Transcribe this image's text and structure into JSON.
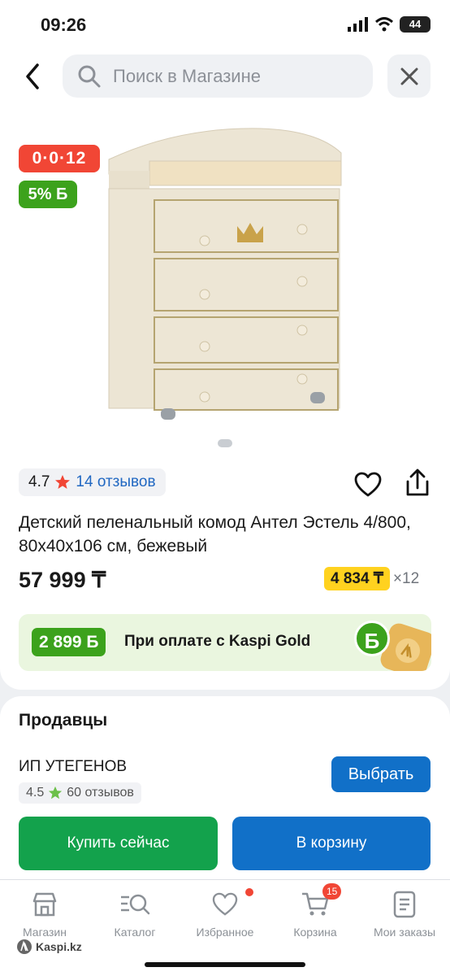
{
  "status_bar": {
    "time": "09:26",
    "battery": "44"
  },
  "search": {
    "placeholder": "Поиск в Магазине"
  },
  "product": {
    "installment_badge": "0·0·12",
    "bonus_badge": "5% Б",
    "rating": "4.7",
    "reviews": "14 отзывов",
    "title": "Детский пеленальный комод Антел Эстель 4/800, 80x40x106 см, бежевый",
    "price": "57 999 ₸",
    "monthly_payment": "4 834 ₸",
    "monthly_term": "×12"
  },
  "kaspi_gold": {
    "bonus_amount": "2 899 Б",
    "text": "При оплате с Kaspi Gold",
    "coin_letter": "Б"
  },
  "sellers": {
    "title": "Продавцы",
    "seller_name": "ИП УТЕГЕНОВ",
    "seller_rating": "4.5",
    "seller_reviews": "60 отзывов",
    "choose_label": "Выбрать"
  },
  "actions": {
    "buy_now": "Купить сейчас",
    "to_cart": "В корзину"
  },
  "nav": {
    "items": [
      {
        "label": "Магазин",
        "icon": "store-icon"
      },
      {
        "label": "Каталог",
        "icon": "catalog-icon"
      },
      {
        "label": "Избранное",
        "icon": "heart-icon"
      },
      {
        "label": "Корзина",
        "icon": "cart-icon"
      },
      {
        "label": "Мои заказы",
        "icon": "orders-icon"
      }
    ],
    "cart_count": "15"
  },
  "watermark": "Kaspi.kz",
  "colors": {
    "red": "#f14635",
    "green": "#3ca21c",
    "blue": "#1170c8",
    "buy_green": "#13a24c",
    "yellow": "#ffd21f"
  }
}
